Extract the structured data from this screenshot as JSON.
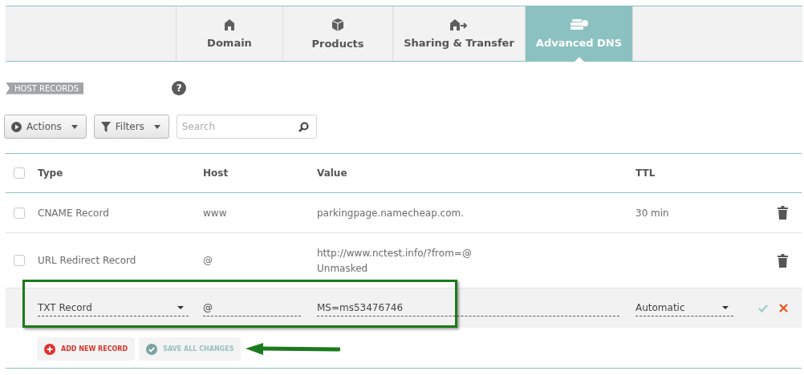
{
  "tabs": [
    {
      "label": "Domain",
      "kind": "house",
      "selected": false
    },
    {
      "label": "Products",
      "kind": "box",
      "selected": false
    },
    {
      "label": "Sharing & Transfer",
      "kind": "share",
      "selected": false
    },
    {
      "label": "Advanced DNS",
      "kind": "server",
      "selected": true
    }
  ],
  "section_label": "HOST RECORDS",
  "help": "?",
  "toolbar": {
    "actions": "Actions",
    "filters": "Filters",
    "search": {
      "placeholder": "Search"
    }
  },
  "table": {
    "select_all": {
      "checked": false
    },
    "columns": [
      "Type",
      "Host",
      "Value",
      "TTL"
    ],
    "rows": [
      {
        "kind": "record",
        "checked": false,
        "type": "CNAME Record",
        "host": "www",
        "value": "parkingpage.namecheap.com.",
        "value_note": "",
        "ttl": "30 min"
      },
      {
        "kind": "record",
        "checked": false,
        "type": "URL Redirect Record",
        "host": "@",
        "value": "http://www.nctest.info/?from=@",
        "value_note": "Unmasked",
        "ttl": ""
      },
      {
        "kind": "edit",
        "type": "TXT Record",
        "host": "@",
        "value": "MS=ms53476746",
        "ttl": "Automatic"
      }
    ]
  },
  "buttons": [
    {
      "kind": "add",
      "label": "ADD NEW RECORD"
    },
    {
      "kind": "save",
      "label": "SAVE ALL CHANGES"
    }
  ]
}
